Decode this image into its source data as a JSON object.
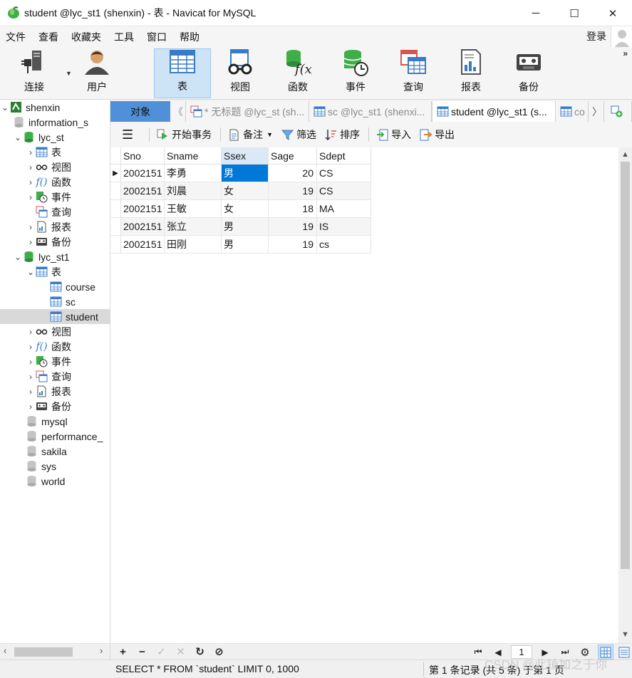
{
  "window": {
    "title": "student @lyc_st1 (shenxin) - 表 - Navicat for MySQL",
    "minimize": "─",
    "maximize": "☐",
    "close": "✕"
  },
  "menu": {
    "items": [
      "文件",
      "查看",
      "收藏夹",
      "工具",
      "窗口",
      "帮助"
    ],
    "login": "登录"
  },
  "toolbar": {
    "items": [
      {
        "label": "连接",
        "icon": "connection-icon"
      },
      {
        "label": "用户",
        "icon": "user-icon"
      },
      {
        "label": "表",
        "icon": "table-icon",
        "active": true
      },
      {
        "label": "视图",
        "icon": "view-icon"
      },
      {
        "label": "函数",
        "icon": "function-icon"
      },
      {
        "label": "事件",
        "icon": "event-icon"
      },
      {
        "label": "查询",
        "icon": "query-icon"
      },
      {
        "label": "报表",
        "icon": "report-icon"
      },
      {
        "label": "备份",
        "icon": "backup-icon"
      }
    ],
    "more": "»"
  },
  "sidebar": {
    "connection": "shenxin",
    "databases_top": [
      "information_s"
    ],
    "lyc_st": {
      "name": "lyc_st",
      "children": [
        "表",
        "视图",
        "函数",
        "事件",
        "查询",
        "报表",
        "备份"
      ]
    },
    "lyc_st1": {
      "name": "lyc_st1",
      "table_folder": "表",
      "tables": [
        "course",
        "sc",
        "student"
      ],
      "children": [
        "视图",
        "函数",
        "事件",
        "查询",
        "报表",
        "备份"
      ]
    },
    "other_dbs": [
      "mysql",
      "performance_",
      "sakila",
      "sys",
      "world"
    ]
  },
  "tabs": {
    "objects": "对象",
    "nav_left": "《",
    "nav_right": "〉",
    "items": [
      {
        "label": "* 无标题 @lyc_st (sh...",
        "icon": "query-tab-icon"
      },
      {
        "label": "sc @lyc_st1 (shenxi...",
        "icon": "table-tab-icon"
      },
      {
        "label": "student @lyc_st1 (s...",
        "icon": "table-tab-icon",
        "current": true
      },
      {
        "label": "co",
        "icon": "table-tab-icon"
      }
    ]
  },
  "actions": {
    "menu": "☰",
    "begin_transaction": "开始事务",
    "note": "备注",
    "filter": "筛选",
    "sort": "排序",
    "import": "导入",
    "export": "导出"
  },
  "grid": {
    "columns": [
      "Sno",
      "Sname",
      "Ssex",
      "Sage",
      "Sdept"
    ],
    "rows": [
      [
        "2002151",
        "李勇",
        "男",
        "20",
        "CS"
      ],
      [
        "2002151",
        "刘晨",
        "女",
        "19",
        "CS"
      ],
      [
        "2002151",
        "王敏",
        "女",
        "18",
        "MA"
      ],
      [
        "2002151",
        "张立",
        "男",
        "19",
        "IS"
      ],
      [
        "2002151",
        "田刚",
        "男",
        "19",
        "cs"
      ]
    ],
    "current_row_marker": "▶"
  },
  "bottom": {
    "add": "+",
    "delete": "−",
    "apply": "✓",
    "discard": "✕",
    "refresh": "↻",
    "stop": "⊘",
    "first": "⏮",
    "prev": "◀",
    "page": "1",
    "next": "▶",
    "last": "⏭",
    "settings": "⚙"
  },
  "status": {
    "sql": "SELECT * FROM `student` LIMIT 0, 1000",
    "records": "第 1 条记录 (共 5 条) 于第 1 页"
  },
  "watermark": "CSDN @此镇加之于你",
  "colors": {
    "accent": "#4f90d8",
    "selection": "#0078d7",
    "active_toolbar": "#cde4f7",
    "db_green": "#3fae49"
  }
}
